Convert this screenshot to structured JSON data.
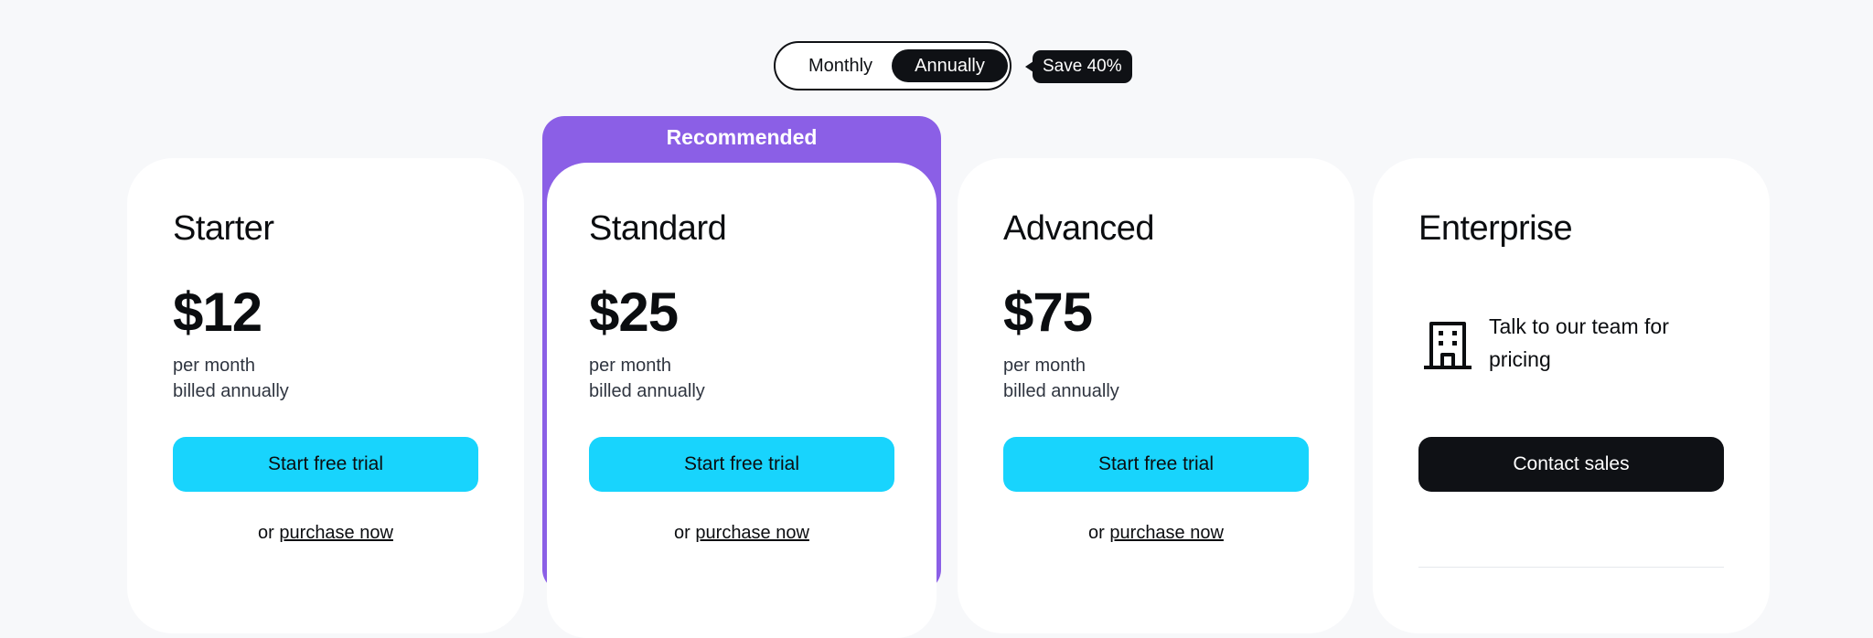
{
  "billing_toggle": {
    "options": [
      "Monthly",
      "Annually"
    ],
    "selected": "Annually",
    "save_badge": "Save 40%"
  },
  "recommended_label": "Recommended",
  "plans": [
    {
      "name": "Starter",
      "price": "$12",
      "per": "per month",
      "billed": "billed annually",
      "cta": "Start free trial",
      "alt_prefix": "or",
      "alt_link": "purchase now"
    },
    {
      "name": "Standard",
      "price": "$25",
      "per": "per month",
      "billed": "billed annually",
      "cta": "Start free trial",
      "alt_prefix": "or",
      "alt_link": "purchase now",
      "recommended": true
    },
    {
      "name": "Advanced",
      "price": "$75",
      "per": "per month",
      "billed": "billed annually",
      "cta": "Start free trial",
      "alt_prefix": "or",
      "alt_link": "purchase now"
    },
    {
      "name": "Enterprise",
      "contact_text": "Talk to our team for pricing",
      "icon": "building-icon",
      "cta": "Contact sales"
    }
  ],
  "colors": {
    "accent_cyan": "#18d4fd",
    "recommended_purple": "#8b5fe6",
    "dark": "#0f1115",
    "background": "#f7f8fa"
  }
}
